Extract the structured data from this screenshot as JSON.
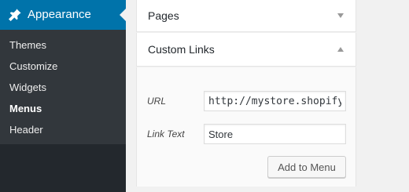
{
  "sidebar": {
    "menu_title": "Appearance",
    "icon": "paintbrush-pin-icon",
    "items": [
      {
        "label": "Themes"
      },
      {
        "label": "Customize"
      },
      {
        "label": "Widgets"
      },
      {
        "label": "Menus"
      },
      {
        "label": "Header"
      }
    ]
  },
  "panels": {
    "pages": {
      "title": "Pages"
    },
    "custom_links": {
      "title": "Custom Links",
      "url_label": "URL",
      "url_value": "http://mystore.shopify.com",
      "link_text_label": "Link Text",
      "link_text_value": "Store",
      "add_button": "Add to Menu"
    }
  },
  "colors": {
    "sidebar_bg": "#23282d",
    "submenu_bg": "#32373c",
    "accent": "#0073aa"
  }
}
